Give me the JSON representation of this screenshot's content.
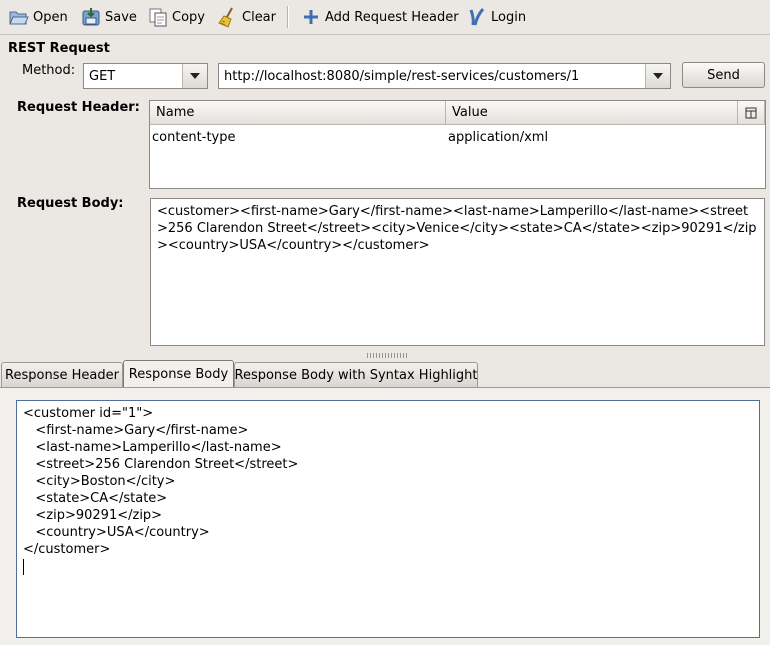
{
  "toolbar": {
    "open": "Open",
    "save": "Save",
    "copy": "Copy",
    "clear": "Clear",
    "add_header": "Add Request Header",
    "login": "Login"
  },
  "request": {
    "section_title": "REST Request",
    "method_label": "Method:",
    "method_value": "GET",
    "url": "http://localhost:8080/simple/rest-services/customers/1",
    "send": "Send",
    "header_label": "Request Header:",
    "header_columns": [
      "Name",
      "Value"
    ],
    "headers": [
      {
        "name": "content-type",
        "value": "application/xml"
      }
    ],
    "body_label": "Request Body:",
    "body": "<customer><first-name>Gary</first-name><last-name>Lamperillo</last-name><street>256 Clarendon Street</street><city>Venice</city><state>CA</state><zip>90291</zip><country>USA</country></customer>"
  },
  "tabs": [
    {
      "label": "Response Header",
      "active": false
    },
    {
      "label": "Response Body",
      "active": true
    },
    {
      "label": "Response Body with Syntax Highlight",
      "active": false
    }
  ],
  "response": {
    "body": "<customer id=\"1\">\n   <first-name>Gary</first-name>\n   <last-name>Lamperillo</last-name>\n   <street>256 Clarendon Street</street>\n   <city>Boston</city>\n   <state>CA</state>\n   <zip>90291</zip>\n   <country>USA</country>\n</customer>"
  }
}
